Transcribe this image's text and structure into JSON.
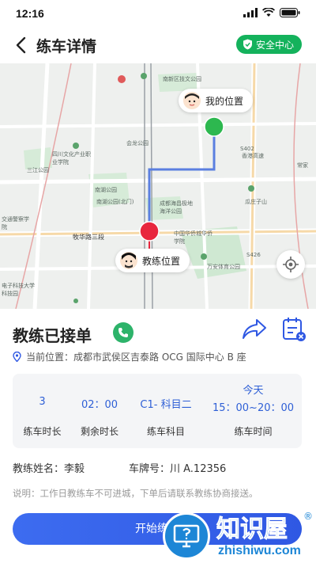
{
  "status_bar": {
    "time": "12:16"
  },
  "nav": {
    "title": "练车详情",
    "safety_center": "安全中心"
  },
  "map": {
    "my_location_label": "我的位置",
    "coach_location_label": "教练位置",
    "place_labels": [
      "南新区技文公园",
      "会龙公园",
      "四川文化产业职业学院",
      "三江公园",
      "南湖公园",
      "南湖公园(北门)",
      "成都海昌极地海洋公园",
      "牧华路三段",
      "中国华侨城华侨学院",
      "万安体育公园",
      "交通警察学院",
      "电子科技大学科技园",
      "香港高速",
      "瓜庄子山",
      "常家",
      "S402",
      "S426"
    ]
  },
  "trip": {
    "status_title": "教练已接单",
    "current_location": "当前位置：成都市武侯区吉泰路 OCG 国际中心 B 座",
    "stats": [
      {
        "value": "3",
        "label": "练车时长"
      },
      {
        "value": "02：00",
        "label": "剩余时长"
      },
      {
        "value": "C1- 科目二",
        "label": "练车科目"
      },
      {
        "value_line1": "今天",
        "value_line2": "15：00~20：00",
        "label": "练车时间"
      }
    ],
    "coach_name": "教练姓名：李毅",
    "plate_number": "车牌号：川 A.12356",
    "note": "说明：工作日教练车不可进城，下单后请联系教练协商接送。",
    "start_button": "开始练车"
  },
  "watermark": {
    "title": "知识屋",
    "domain": "zhishiwu.com",
    "registered": "®"
  },
  "colors": {
    "primary_blue": "#2f58e3",
    "success_green": "#14b25c",
    "marker_green": "#2db84f",
    "marker_red": "#e8263e",
    "route_blue": "#5b7fe0"
  }
}
